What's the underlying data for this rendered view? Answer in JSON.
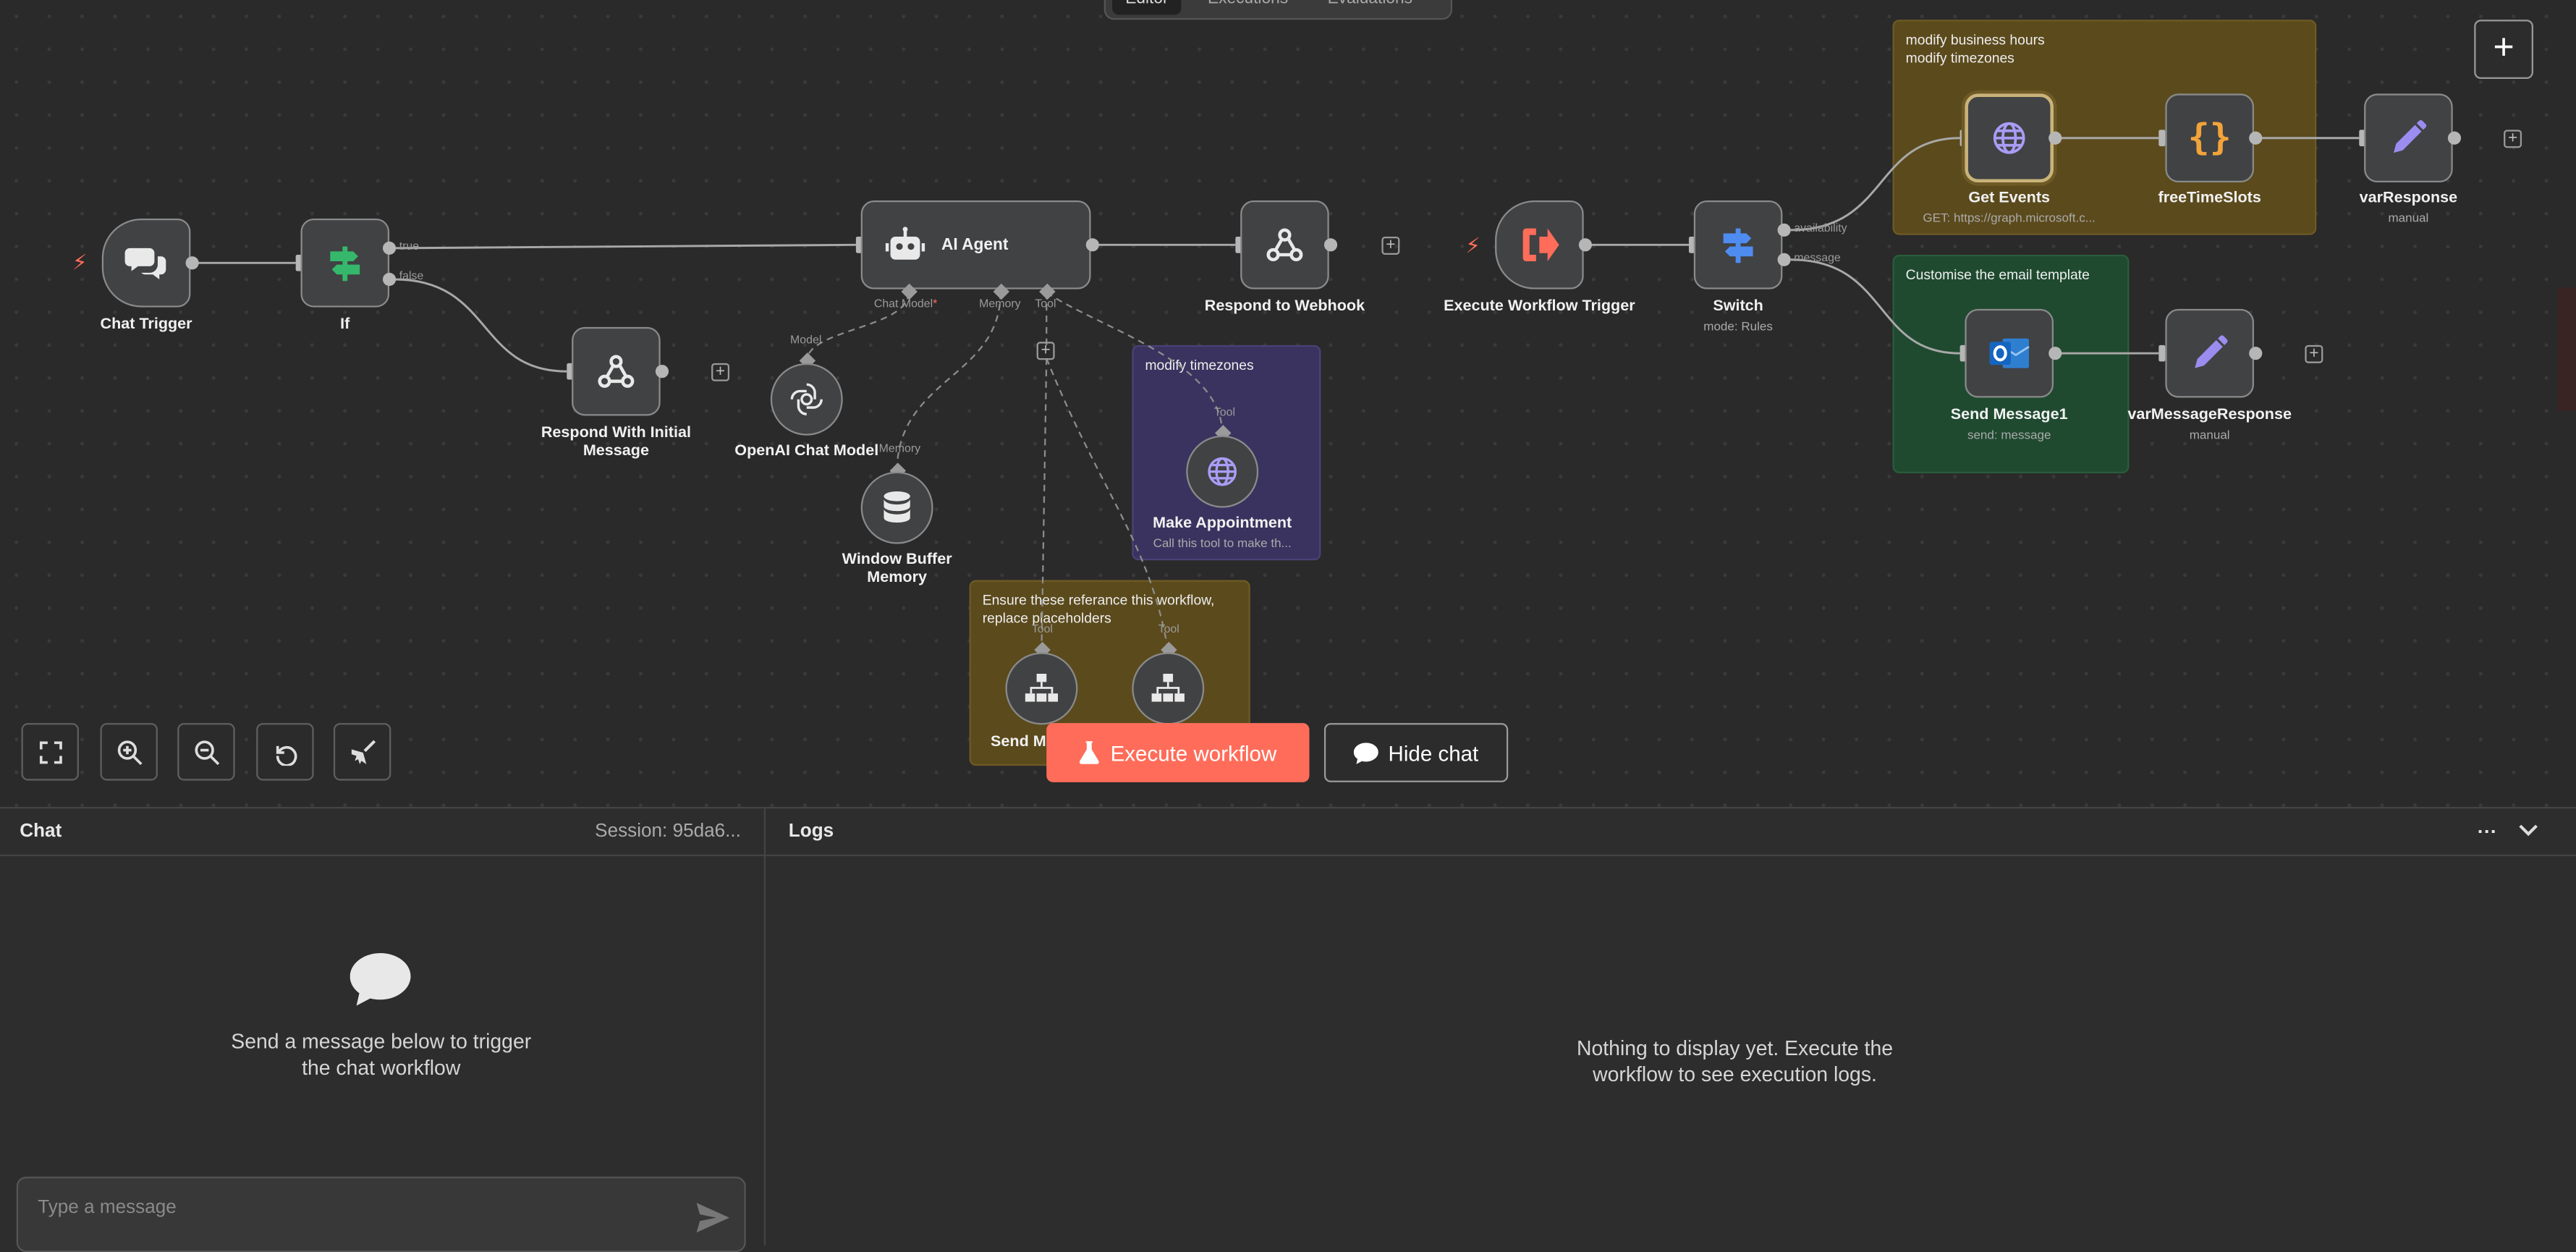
{
  "top_tabs": [
    "Editor",
    "Executions",
    "Evaluations"
  ],
  "stickies": {
    "hours": [
      "modify business hours",
      "modify timezones"
    ],
    "email": [
      "Customise the email template"
    ],
    "purple": [
      "modify timezones"
    ],
    "refs": [
      "Ensure these referance this workflow,",
      "replace placeholders"
    ]
  },
  "nodes": {
    "chat_trigger": "Chat Trigger",
    "if": "If",
    "if_true": "true",
    "if_false": "false",
    "respond_initial": "Respond With Initial Message",
    "ai_agent": "AI Agent",
    "chat_model_port": "Chat Model",
    "chat_model_required": "*",
    "memory_port": "Memory",
    "tool_port": "Tool",
    "openai": "OpenAI Chat Model",
    "model_port": "Model",
    "window_memory": "Window Buffer Memory",
    "memory_in_port": "Memory",
    "respond_webhook": "Respond to Webhook",
    "make_appointment": "Make Appointment",
    "make_appointment_sub": "Call this tool to make th...",
    "tool_label": "Tool",
    "send_message_partial": "Send Me",
    "exec_trigger": "Execute Workflow Trigger",
    "switch": "Switch",
    "switch_sub": "mode: Rules",
    "switch_out_availability": "availability",
    "switch_out_message": "message",
    "get_events": "Get Events",
    "get_events_sub": "GET: https://graph.microsoft.c...",
    "free_slots": "freeTimeSlots",
    "var_response": "varResponse",
    "var_response_sub": "manual",
    "send_message1": "Send Message1",
    "send_message1_sub": "send: message",
    "var_message_response": "varMessageResponse",
    "var_message_response_sub": "manual"
  },
  "buttons": {
    "add": "+",
    "execute": "Execute workflow",
    "hide_chat": "Hide chat"
  },
  "chat": {
    "title": "Chat",
    "session": "Session: 95da6...",
    "empty_line1": "Send a message below to trigger",
    "empty_line2": "the chat workflow",
    "placeholder": "Type a message"
  },
  "logs": {
    "title": "Logs",
    "more": "···",
    "empty_line1": "Nothing to display yet. Execute the",
    "empty_line2": "workflow to see execution logs."
  },
  "colors": {
    "accent": "#ff6d5a",
    "canvas": "#2a2a2a",
    "node": "#414244"
  }
}
